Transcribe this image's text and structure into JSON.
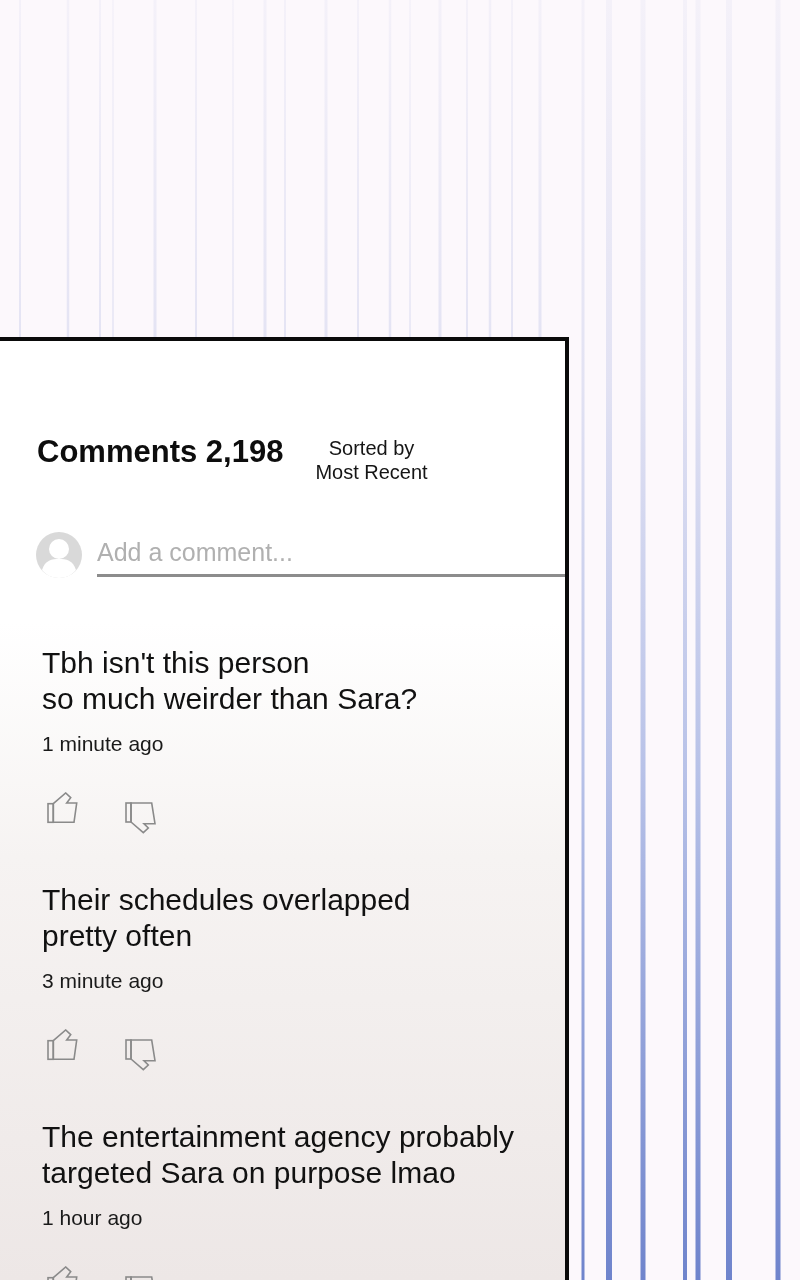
{
  "header": {
    "title": "Comments 2,198",
    "sort": {
      "label": "Sorted by",
      "value": "Most Recent"
    }
  },
  "comment_box": {
    "placeholder": "Add a comment..."
  },
  "comments": [
    {
      "text": "Tbh isn't this person\nso much weirder than Sara?",
      "time": "1 minute ago"
    },
    {
      "text": "Their schedules overlapped\npretty often",
      "time": "3 minute ago"
    },
    {
      "text": "The entertainment agency probably\ntargeted Sara on purpose lmao",
      "time": "1 hour ago"
    }
  ]
}
